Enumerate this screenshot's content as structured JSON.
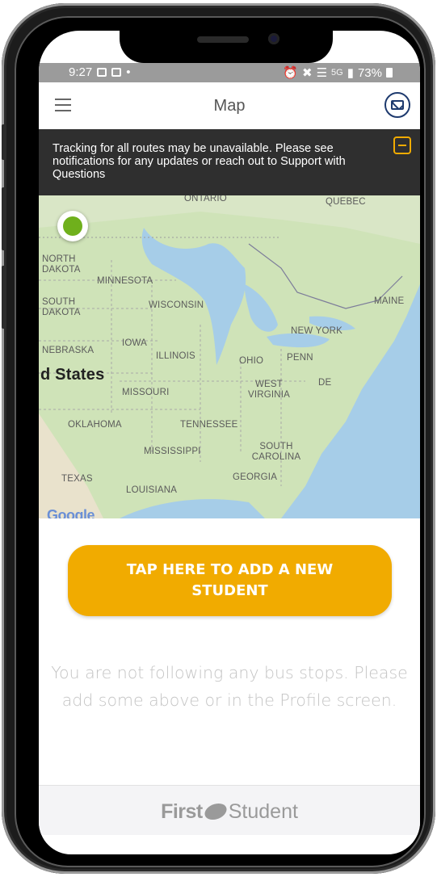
{
  "status_bar": {
    "time": "9:27",
    "network": "5G",
    "battery": "73%"
  },
  "header": {
    "title": "Map",
    "menu_icon": "hamburger-menu-icon",
    "mail_icon": "mail-icon"
  },
  "banner": {
    "text": "Tracking for all routes may be unavailable. Please see notifications for any updates or reach out to Support with Questions",
    "accent_color": "#f1ab00"
  },
  "map": {
    "labels": [
      "ONTARIO",
      "QUEBEC",
      "NORTH DAKOTA",
      "MINNESOTA",
      "SOUTH DAKOTA",
      "WISCONSIN",
      "MAINE",
      "NEW YORK",
      "IOWA",
      "NEBRASKA",
      "ILLINOIS",
      "OHIO",
      "PENN",
      "d States",
      "WEST VIRGINIA",
      "DE",
      "MISSOURI",
      "OKLAHOMA",
      "TENNESSEE",
      "SOUTH CAROLINA",
      "MISSISSIPPI",
      "GEORGIA",
      "TEXAS",
      "LOUISIANA"
    ],
    "google_logo": "Google",
    "pin_color": "#6fb01c"
  },
  "actions": {
    "add_student_label": "TAP HERE TO ADD A NEW STUDENT",
    "button_color": "#f1ab00"
  },
  "empty_state": {
    "message": "You are not following any bus stops. Please add some above or in the Profile screen."
  },
  "footer": {
    "brand_first": "First",
    "brand_second": "Student"
  }
}
